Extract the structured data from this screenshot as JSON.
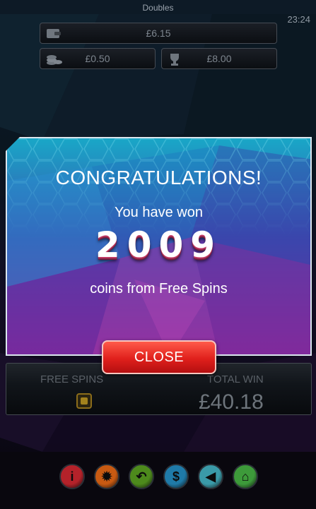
{
  "header": {
    "title": "Doubles",
    "clock": "23:24"
  },
  "balances": {
    "wallet": {
      "icon": "wallet-icon",
      "value": "£6.15"
    },
    "stake": {
      "icon": "coin-stack-icon",
      "value": "£0.50"
    },
    "win": {
      "icon": "trophy-icon",
      "value": "£8.00"
    }
  },
  "panel": {
    "free_spins_label": "FREE SPINS",
    "total_win_label": "TOTAL WIN",
    "total_win_value": "£40.18"
  },
  "popup": {
    "heading": "CONGRATULATIONS!",
    "line1": "You have won",
    "amount": "2009",
    "line2": "coins from Free Spins",
    "close_label": "CLOSE"
  },
  "toolbar": {
    "buttons": [
      {
        "icon": "info-icon",
        "glyph": "i",
        "color": "#b4222a"
      },
      {
        "icon": "settings-icon",
        "glyph": "✹",
        "color": "#c85a12"
      },
      {
        "icon": "back-icon",
        "glyph": "↶",
        "color": "#4d8a1c"
      },
      {
        "icon": "paytable-icon",
        "glyph": "$",
        "color": "#1f7aa8"
      },
      {
        "icon": "sound-icon",
        "glyph": "◀",
        "color": "#3a9aa8"
      },
      {
        "icon": "home-icon",
        "glyph": "⌂",
        "color": "#3d9a3a"
      }
    ]
  },
  "colors": {
    "popup_bg_top": "#19a7c7",
    "popup_bg_bottom": "#8a2a9a",
    "close_button": "#e0201c"
  }
}
